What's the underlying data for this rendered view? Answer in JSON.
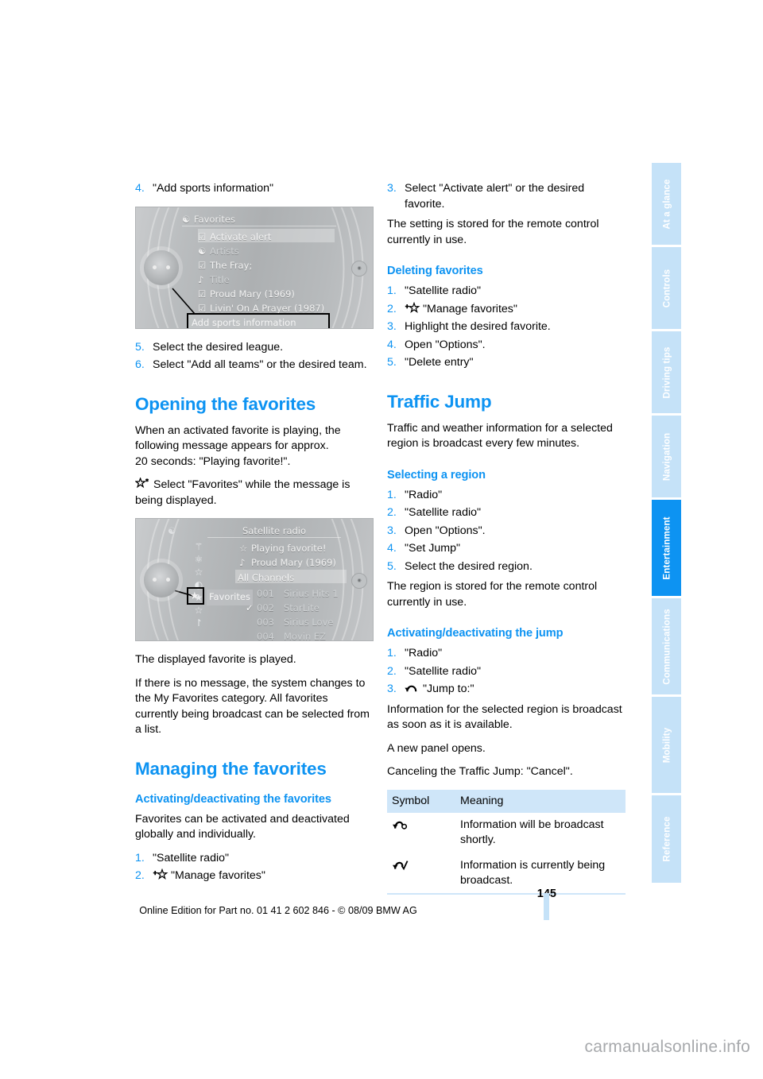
{
  "page": {
    "number": "145",
    "imprint": "Online Edition for Part no. 01 41 2 602 846 - © 08/09 BMW AG",
    "watermark": "carmanualsonline.info",
    "accent_color": "#0d93f2",
    "tab_inactive_color": "#c5e2f8",
    "table_header_color": "#cfe6f9"
  },
  "tabs": [
    {
      "label": "At a glance",
      "active": false
    },
    {
      "label": "Controls",
      "active": false
    },
    {
      "label": "Driving tips",
      "active": false
    },
    {
      "label": "Navigation",
      "active": false
    },
    {
      "label": "Entertainment",
      "active": true
    },
    {
      "label": "Communications",
      "active": false
    },
    {
      "label": "Mobility",
      "active": false
    },
    {
      "label": "Reference",
      "active": false
    }
  ],
  "left_column": {
    "step4": {
      "num": "4.",
      "text": "\"Add sports information\""
    },
    "screenshot1": {
      "title": "Favorites",
      "rows": [
        {
          "icon": "checkbox-icon",
          "label": "Activate alert"
        },
        {
          "icon": "artist-icon",
          "label": "Artists"
        },
        {
          "icon": "checkbox-icon",
          "label": "The Fray;"
        },
        {
          "icon": "note-icon",
          "label": "Title"
        },
        {
          "icon": "checkbox-icon",
          "label": "Proud Mary (1969)"
        },
        {
          "icon": "checkbox-icon",
          "label": "Livin' On A Prayer (1987)"
        }
      ],
      "callout": "Add sports information"
    },
    "step5": {
      "num": "5.",
      "text": "Select the desired league."
    },
    "step6": {
      "num": "6.",
      "text": "Select \"Add all teams\" or the desired team."
    },
    "opening_heading": "Opening the favorites",
    "opening_para": "When an activated favorite is playing, the following message appears for approx.\n20 seconds: \"Playing favorite!\".",
    "opening_bullet": "Select \"Favorites\" while the message is being displayed.",
    "screenshot2": {
      "title": "Satellite radio",
      "now_playing_star_row": "Playing favorite!",
      "now_playing_track_row": "Proud Mary (1969)",
      "category_row": "All Channels",
      "channels": [
        {
          "check": "",
          "number": "001",
          "name": "Sirius Hits 1"
        },
        {
          "check": "✓",
          "number": "002",
          "name": "StarLite"
        },
        {
          "check": "",
          "number": "003",
          "name": "Sirius Love"
        },
        {
          "check": "",
          "number": "004",
          "name": "Movin EZ"
        }
      ],
      "callout": "Favorites"
    },
    "after_shot2_para1": "The displayed favorite is played.",
    "after_shot2_para2": "If there is no message, the system changes to the My Favorites category. All favorites currently being broadcast can be selected from a list.",
    "managing_heading": "Managing the favorites",
    "activating_heading": "Activating/deactivating the favorites",
    "activating_para": "Favorites can be activated and deactivated globally and individually.",
    "activating_steps": [
      {
        "num": "1.",
        "text": "\"Satellite radio\"",
        "icon": ""
      },
      {
        "num": "2.",
        "text": "\"Manage favorites\"",
        "icon": "plus-star-icon"
      }
    ]
  },
  "right_column": {
    "step3": {
      "num": "3.",
      "text": "Select \"Activate alert\" or the desired favorite."
    },
    "setting_para": "The setting is stored for the remote control currently in use.",
    "deleting_heading": "Deleting favorites",
    "deleting_steps": [
      {
        "num": "1.",
        "text": "\"Satellite radio\"",
        "icon": ""
      },
      {
        "num": "2.",
        "text": "\"Manage favorites\"",
        "icon": "plus-star-icon"
      },
      {
        "num": "3.",
        "text": "Highlight the desired favorite.",
        "icon": ""
      },
      {
        "num": "4.",
        "text": "Open \"Options\".",
        "icon": ""
      },
      {
        "num": "5.",
        "text": "\"Delete entry\"",
        "icon": ""
      }
    ],
    "traffic_heading": "Traffic Jump",
    "traffic_para": "Traffic and weather information for a selected region is broadcast every few minutes.",
    "selecting_heading": "Selecting a region",
    "selecting_steps": [
      {
        "num": "1.",
        "text": "\"Radio\"",
        "icon": ""
      },
      {
        "num": "2.",
        "text": "\"Satellite radio\"",
        "icon": ""
      },
      {
        "num": "3.",
        "text": "Open \"Options\".",
        "icon": ""
      },
      {
        "num": "4.",
        "text": "\"Set Jump\"",
        "icon": ""
      },
      {
        "num": "5.",
        "text": "Select the desired region.",
        "icon": ""
      }
    ],
    "region_para": "The region is stored for the remote control currently in use.",
    "jump_heading": "Activating/deactivating the jump",
    "jump_steps": [
      {
        "num": "1.",
        "text": "\"Radio\"",
        "icon": ""
      },
      {
        "num": "2.",
        "text": "\"Satellite radio\"",
        "icon": ""
      },
      {
        "num": "3.",
        "text": "\"Jump to:\"",
        "icon": "jump-arc-icon"
      }
    ],
    "jump_para1": "Information for the selected region is broadcast as soon as it is available.",
    "jump_para2": "A new panel opens.",
    "jump_para3": "Canceling the Traffic Jump: \"Cancel\".",
    "symbol_table": {
      "headers": [
        "Symbol",
        "Meaning"
      ],
      "rows": [
        {
          "icon": "arc-circle-icon",
          "meaning": "Information will be broadcast shortly."
        },
        {
          "icon": "arc-check-icon",
          "meaning": "Information is currently being broadcast."
        }
      ]
    }
  }
}
